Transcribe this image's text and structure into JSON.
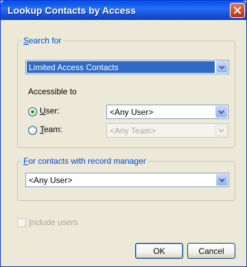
{
  "window": {
    "title": "Lookup Contacts by Access"
  },
  "search_for": {
    "legend": "Search for",
    "legend_mnemonic": "S",
    "legend_rest": "earch for",
    "selected": "Limited Access Contacts"
  },
  "accessible_to": {
    "label": "Accessible to",
    "user": {
      "mnemonic": "U",
      "rest": "ser:",
      "checked": true,
      "selected": "<Any User>"
    },
    "team": {
      "mnemonic": "T",
      "rest": "eam:",
      "checked": false,
      "selected": "<Any Team>",
      "enabled": false
    }
  },
  "record_manager": {
    "legend_mnemonic": "F",
    "legend_rest": "or contacts with record manager",
    "selected": "<Any User>"
  },
  "include_users": {
    "mnemonic": "I",
    "rest": "nclude users",
    "checked": false,
    "enabled": false
  },
  "buttons": {
    "ok": "OK",
    "cancel": "Cancel"
  },
  "icons": {
    "close": "close-icon",
    "dropdown": "chevron-down-icon"
  },
  "colors": {
    "title_bar": "#0554e6",
    "selection": "#316ac5",
    "legend_text": "#0046d5",
    "close_button": "#d2472c"
  }
}
